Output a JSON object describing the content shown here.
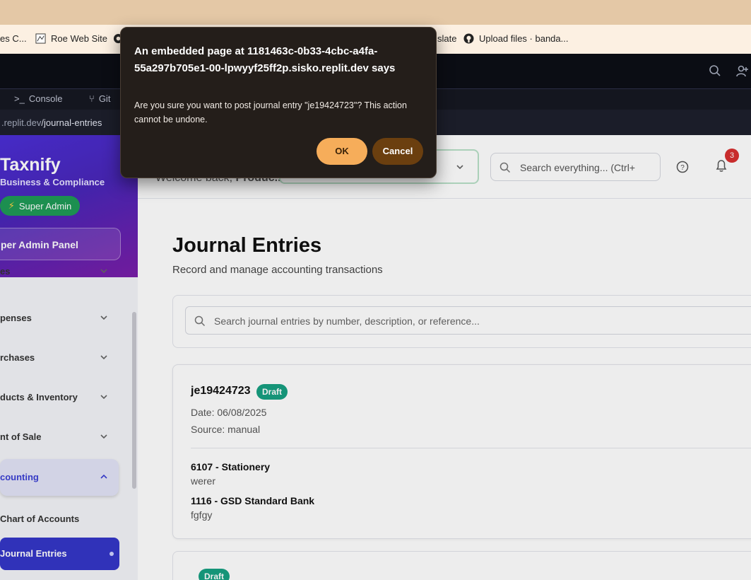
{
  "browser": {
    "bookmarks": [
      {
        "label": "es C...",
        "icon": "bookmark-icon"
      },
      {
        "label": "Roe Web Site",
        "icon": "roe-site-icon"
      },
      {
        "label": "slate",
        "icon": "globe-icon"
      },
      {
        "label": "Upload files · banda...",
        "icon": "github-icon"
      }
    ]
  },
  "replit": {
    "tabs": [
      {
        "label": "Console"
      },
      {
        "label": "Git"
      }
    ],
    "url": {
      "host": ".replit.dev",
      "path": "/journal-entries"
    }
  },
  "sidebar": {
    "brand_name": "Taxnify",
    "brand_subtitle": "Business & Compliance",
    "role_badge": "Super Admin",
    "admin_panel": "per Admin Panel",
    "nav": [
      {
        "label": "es"
      },
      {
        "label": "penses"
      },
      {
        "label": "rchases"
      },
      {
        "label": "ducts & Inventory"
      },
      {
        "label": "nt of Sale"
      },
      {
        "label": "counting"
      }
    ],
    "sub_items": [
      {
        "label": "Chart of Accounts"
      },
      {
        "label": "Journal Entries"
      }
    ]
  },
  "header": {
    "welcome_text": "Welcome back, ",
    "welcome_name": "Produc...",
    "search_placeholder": "Search everything... (Ctrl+",
    "notification_count": "3"
  },
  "main": {
    "title": "Journal Entries",
    "subtitle": "Record and manage accounting transactions",
    "search_placeholder": "Search journal entries by number, description, or reference...",
    "entries": [
      {
        "number": "je19424723",
        "status": "Draft",
        "date": "Date: 06/08/2025",
        "source": "Source: manual",
        "lines": [
          {
            "account": "6107 - Stationery",
            "description": "werer"
          },
          {
            "account": "1116 - GSD Standard Bank",
            "description": "fgfgy"
          }
        ]
      },
      {
        "status": "Draft"
      }
    ]
  },
  "dialog": {
    "title": "An embedded page at 1181463c-0b33-4cbc-a4fa-55a297b705e1-00-lpwyyf25ff2p.sisko.replit.dev says",
    "message": "Are you sure you want to post journal entry \"je19424723\"? This action cannot be undone.",
    "ok_label": "OK",
    "cancel_label": "Cancel"
  },
  "colors": {
    "dialog_bg": "#241e1a",
    "ok_button": "#f6ad5a",
    "cancel_button": "#6b3f0f",
    "brand_gradient_start": "#4b2fd6",
    "active_nav": "#3436c8",
    "draft_badge": "#17a082",
    "notification_badge": "#d83030"
  }
}
